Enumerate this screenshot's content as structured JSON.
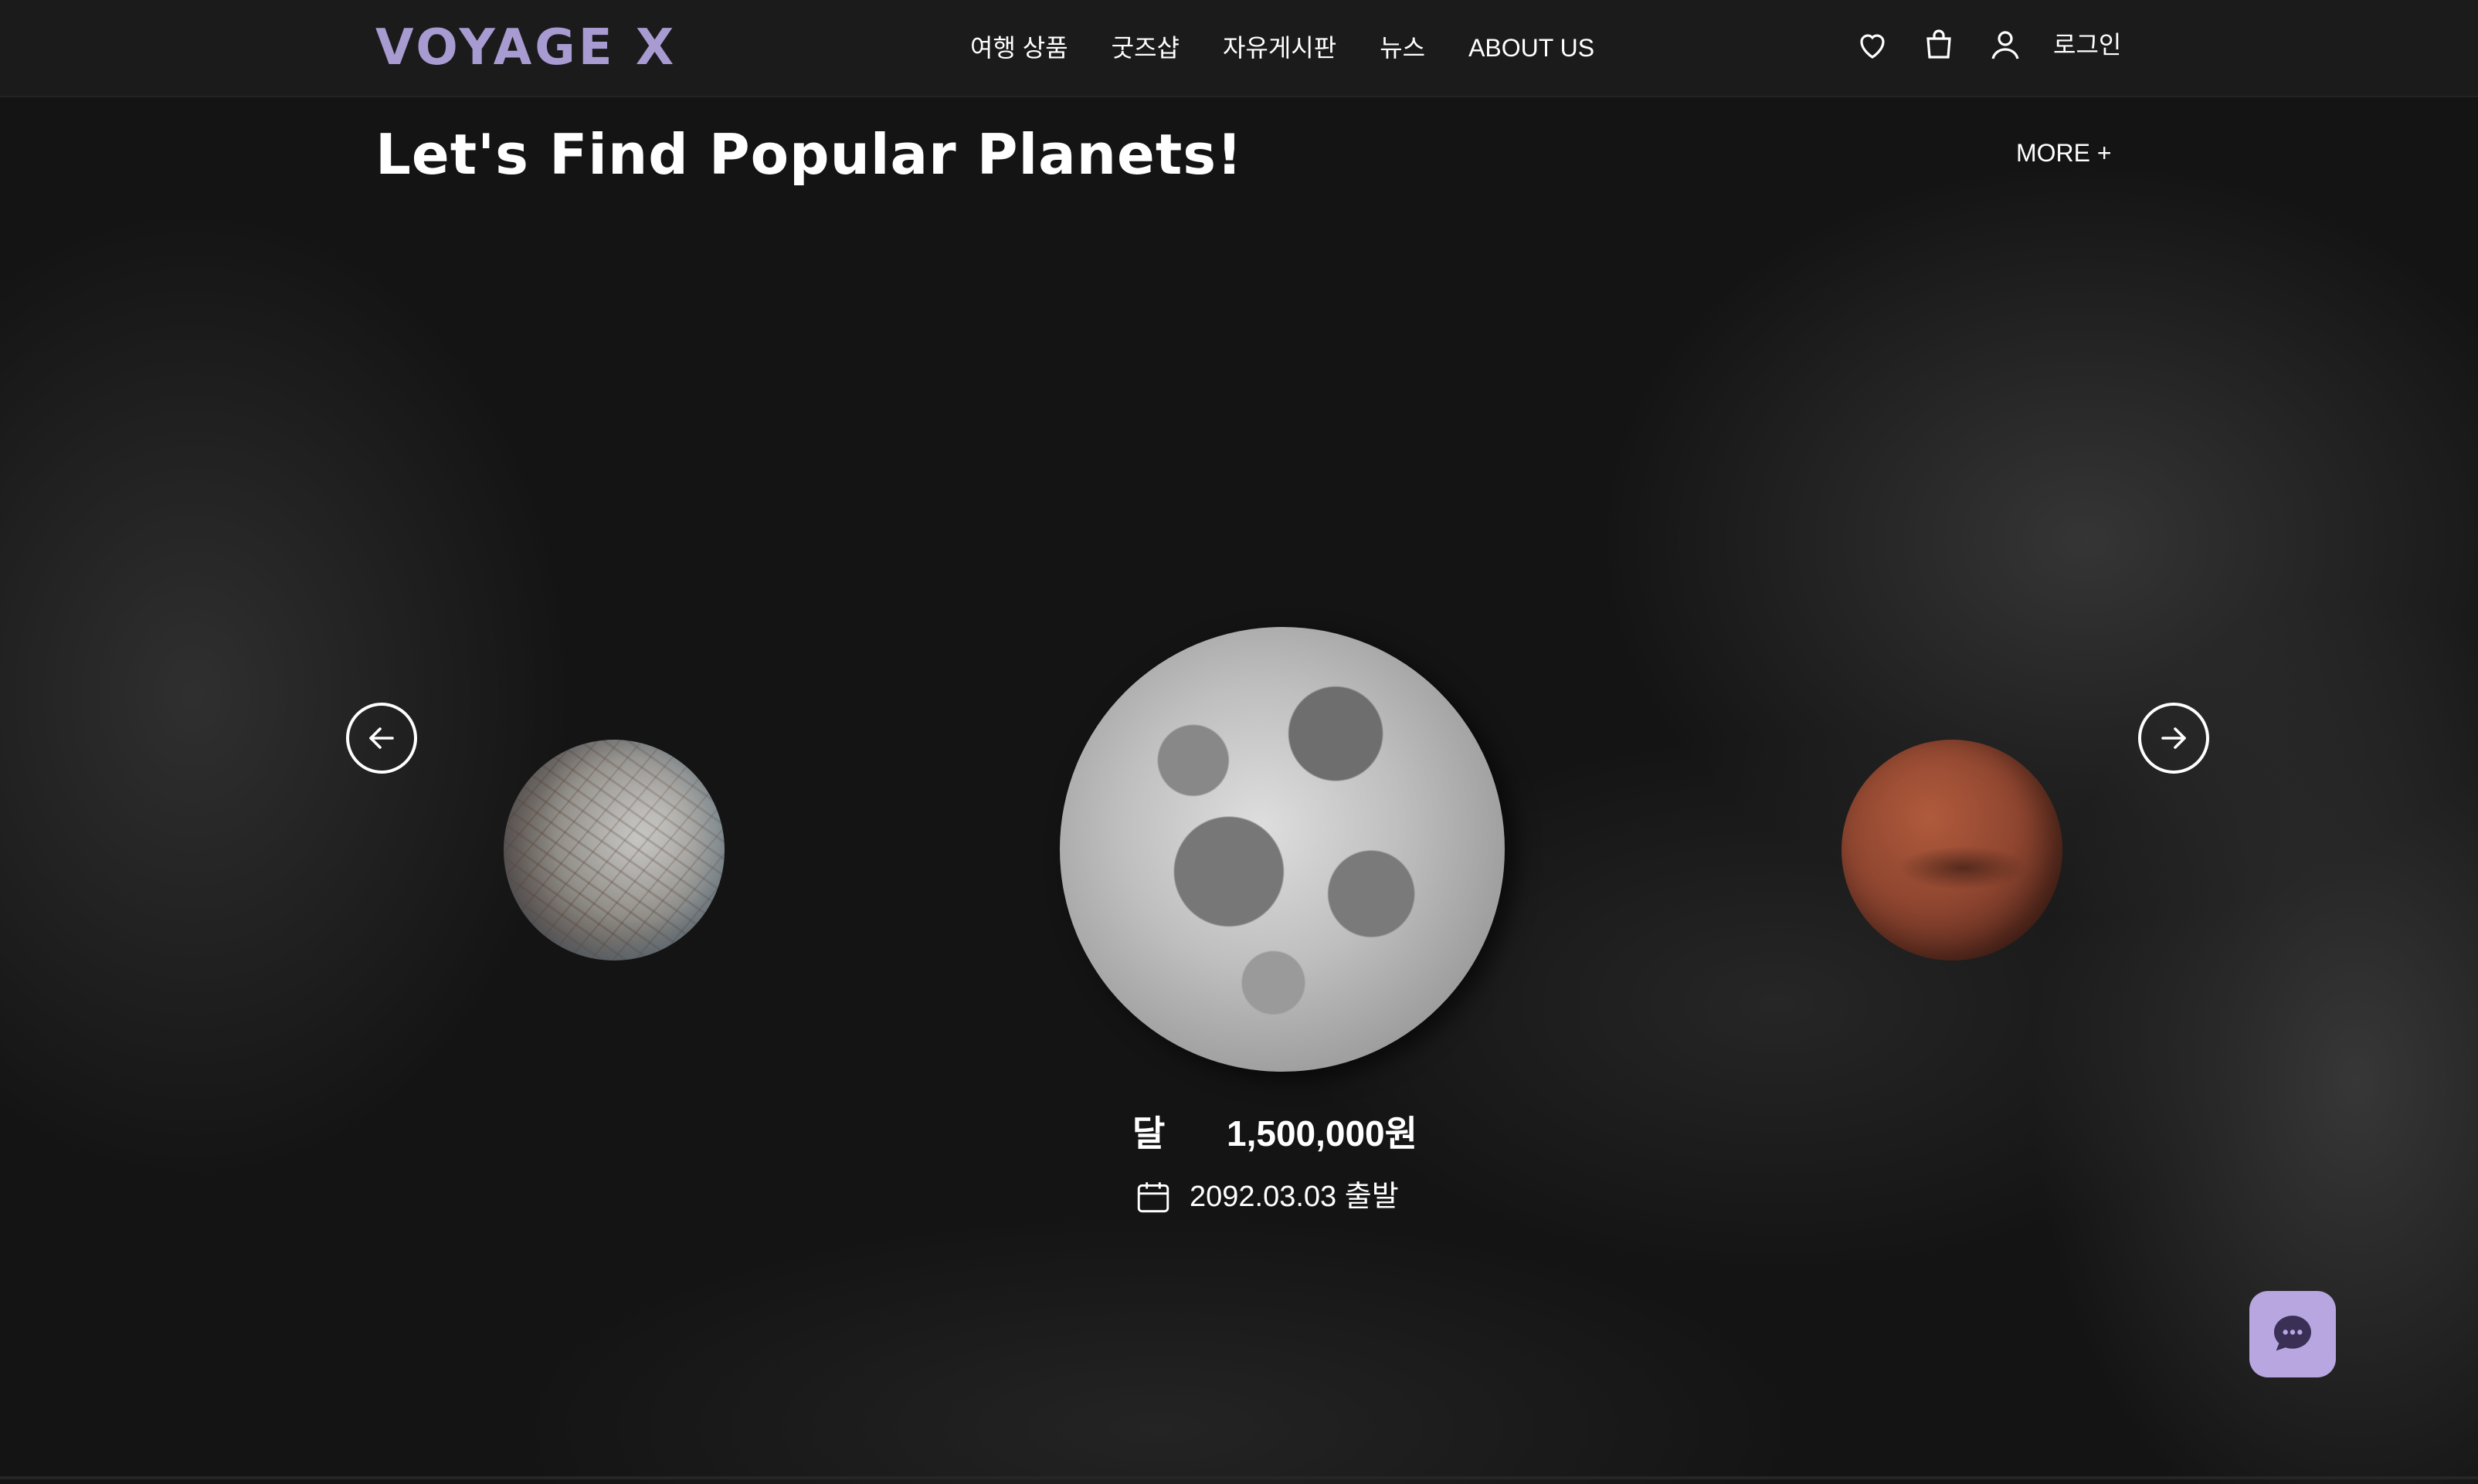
{
  "header": {
    "logo": "VOYAGE X",
    "nav": [
      "여행 상품",
      "굿즈샵",
      "자유게시판",
      "뉴스",
      "ABOUT US"
    ],
    "icons": [
      "heart-icon",
      "shopping-bag-icon",
      "user-icon"
    ],
    "login_label": "로그인"
  },
  "section": {
    "title": "Let's Find Popular Planets!",
    "more_label": "MORE +"
  },
  "carousel": {
    "planets": [
      "europa-like-planet",
      "moon",
      "mars"
    ],
    "featured": {
      "name": "달",
      "price": "1,500,000원",
      "date_label": "2092.03.03 출발"
    },
    "prev_icon": "arrow-left-icon",
    "next_icon": "arrow-right-icon"
  },
  "chat": {
    "icon": "chat-bubble-icon"
  },
  "colors": {
    "accent": "#a89bd1",
    "chat_bg": "#b7a6e0",
    "chat_icon": "#3a2f55"
  }
}
